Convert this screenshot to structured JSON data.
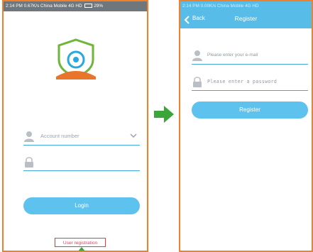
{
  "login_screen": {
    "status_bar": {
      "time": "2:14 PM",
      "speed": "0.67K/s",
      "carrier": "China Mobile 4G HD",
      "battery": "29%"
    },
    "account_placeholder": "Account number",
    "password_placeholder": "",
    "login_label": "Login",
    "register_link": "User registration",
    "colors": {
      "accent": "#5dc2ed",
      "frame": "#f0812a",
      "highlight": "#e23c3c",
      "logo_shield": "#6fb53a",
      "logo_base": "#e8752a"
    }
  },
  "transition_arrow": {
    "color": "#3aa63a",
    "icon": "right-arrow-icon"
  },
  "register_screen": {
    "status_bar": {
      "time": "2:14 PM",
      "speed": "0.00K/s",
      "carrier": "China Mobile 4G HD"
    },
    "nav": {
      "back_label": "Back",
      "title": "Register"
    },
    "email_placeholder": "Please enter your e-mail",
    "password_placeholder": "Please enter a password",
    "register_label": "Register"
  }
}
